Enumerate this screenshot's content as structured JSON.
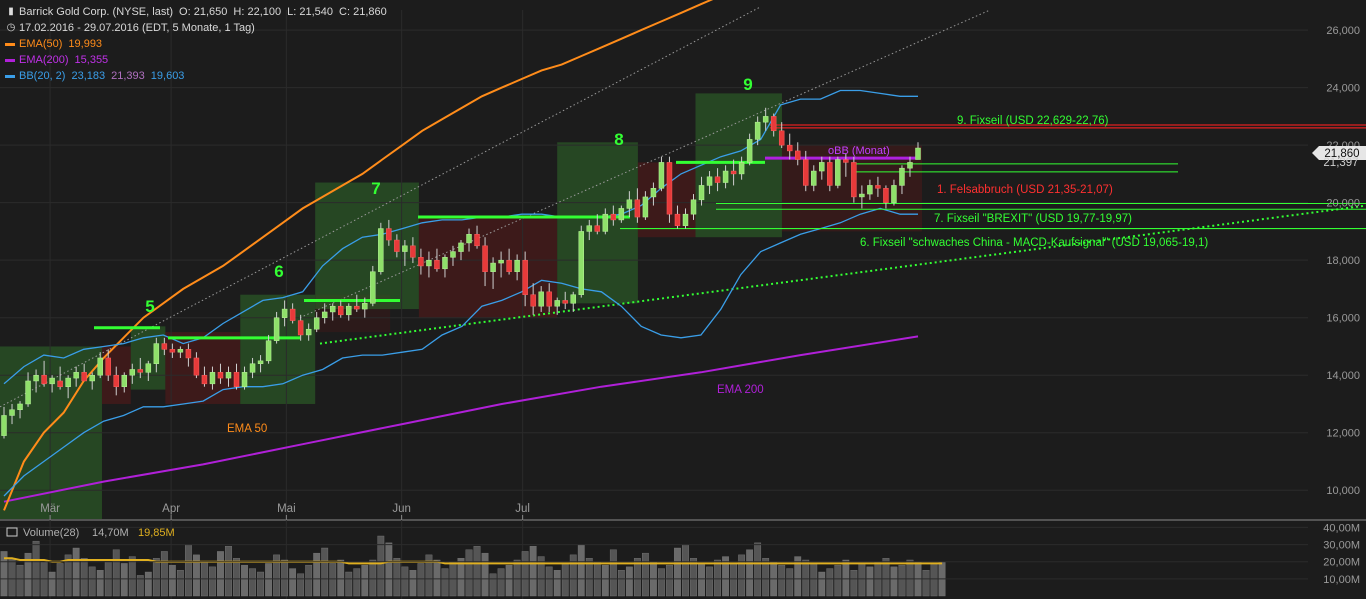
{
  "header": {
    "title": "Barrick Gold Corp. (NYSE, last)",
    "open_label": "O:",
    "open": "21,650",
    "high_label": "H:",
    "high": "22,100",
    "low_label": "L:",
    "low": "21,540",
    "close_label": "C:",
    "close": "21,860",
    "period": "17.02.2016 - 29.07.2016 (EDT, 5 Monate, 1 Tag)"
  },
  "indicators": {
    "ema50": {
      "label": "EMA(50)",
      "value": "19,993",
      "color": "#ff8c1a"
    },
    "ema200": {
      "label": "EMA(200)",
      "value": "15,355",
      "color": "#b020d8"
    },
    "bb": {
      "label": "BB(20, 2)",
      "upper": "23,183",
      "middle": "21,393",
      "lower": "19,603",
      "color": "#3a9ee8",
      "middle_color": "#b070c0"
    }
  },
  "volume_legend": {
    "label": "Volume(28)",
    "avg": "14,70M",
    "last": "19,85M",
    "avg_color": "#e0b020"
  },
  "last_price_tag": "21,860",
  "hidden_price_tag": "21,397",
  "annotations": {
    "wave_5": "5",
    "wave_6": "6",
    "wave_7": "7",
    "wave_8": "8",
    "wave_9": "9",
    "fix9": "9. Fixseil  (USD 22,629-22,76)",
    "obb": "oBB (Monat)",
    "fels1": "1. Felsabbruch (USD 21,35-21,07)",
    "fix7": "7. Fixseil  \"BREXIT\" (USD 19,77-19,97)",
    "fix6": "6. Fixseil  \"schwaches China - MACD-Kaufsignal\" (USD 19,065-19,1)",
    "ema50_label": "EMA 50",
    "ema200_label": "EMA 200"
  },
  "colors": {
    "background": "#1c1c1c",
    "up_candle": "#8fe06a",
    "down_candle": "#e83a3a",
    "green_line": "#33ff33",
    "red_line": "#e02020",
    "label_red": "#ff3030"
  },
  "chart_data": {
    "type": "candlestick",
    "ylim": [
      9.0,
      26.7
    ],
    "y_ticks": [
      "26,000",
      "24,000",
      "22,000",
      "20,000",
      "18,000",
      "16,000",
      "14,000",
      "12,000",
      "10,000"
    ],
    "y_tick_values": [
      26,
      24,
      22,
      20,
      18,
      16,
      14,
      12,
      10
    ],
    "x_labels": [
      {
        "label": "Mär",
        "index": 8
      },
      {
        "label": "Apr",
        "index": 29
      },
      {
        "label": "Mai",
        "index": 49
      },
      {
        "label": "Jun",
        "index": 69
      },
      {
        "label": "Jul",
        "index": 90
      }
    ],
    "volume_ticks": [
      "40,00M",
      "30,00M",
      "20,00M",
      "10,00M"
    ],
    "volume_tick_values": [
      40,
      30,
      20,
      10
    ],
    "volume_ylim": [
      0,
      42
    ],
    "candles": [
      [
        11.9,
        12.9,
        11.8,
        12.6
      ],
      [
        12.6,
        13.0,
        12.3,
        12.8
      ],
      [
        12.8,
        13.1,
        12.5,
        13.0
      ],
      [
        13.0,
        14.1,
        12.9,
        13.8
      ],
      [
        13.8,
        14.2,
        13.4,
        14.0
      ],
      [
        14.0,
        14.5,
        13.6,
        13.7
      ],
      [
        13.7,
        14.0,
        13.4,
        13.9
      ],
      [
        13.8,
        14.3,
        13.5,
        13.6
      ],
      [
        13.6,
        14.0,
        13.2,
        13.9
      ],
      [
        13.9,
        14.3,
        13.6,
        14.1
      ],
      [
        14.1,
        14.4,
        13.8,
        13.8
      ],
      [
        13.8,
        14.1,
        13.5,
        14.0
      ],
      [
        14.0,
        14.8,
        13.9,
        14.6
      ],
      [
        14.6,
        14.9,
        13.8,
        14.0
      ],
      [
        14.0,
        14.3,
        13.3,
        13.6
      ],
      [
        13.6,
        14.1,
        13.4,
        14.0
      ],
      [
        14.0,
        14.4,
        13.7,
        14.2
      ],
      [
        14.2,
        14.6,
        13.9,
        14.1
      ],
      [
        14.1,
        14.5,
        13.8,
        14.4
      ],
      [
        14.4,
        15.3,
        14.1,
        15.1
      ],
      [
        15.1,
        15.3,
        14.7,
        14.9
      ],
      [
        14.9,
        15.1,
        14.6,
        14.8
      ],
      [
        14.8,
        15.0,
        14.6,
        14.9
      ],
      [
        14.9,
        15.1,
        14.3,
        14.6
      ],
      [
        14.6,
        14.8,
        13.9,
        14.0
      ],
      [
        14.0,
        14.3,
        13.6,
        13.7
      ],
      [
        13.7,
        14.3,
        13.5,
        14.1
      ],
      [
        14.1,
        14.4,
        13.7,
        13.9
      ],
      [
        13.9,
        14.3,
        13.6,
        14.1
      ],
      [
        14.1,
        14.4,
        13.5,
        13.6
      ],
      [
        13.6,
        14.3,
        13.5,
        14.1
      ],
      [
        14.1,
        14.6,
        13.9,
        14.4
      ],
      [
        14.4,
        14.7,
        14.1,
        14.5
      ],
      [
        14.5,
        15.4,
        14.4,
        15.2
      ],
      [
        15.2,
        16.2,
        15.1,
        16.0
      ],
      [
        16.0,
        16.6,
        15.7,
        16.3
      ],
      [
        16.3,
        16.5,
        15.8,
        15.9
      ],
      [
        15.9,
        16.1,
        15.2,
        15.4
      ],
      [
        15.4,
        15.8,
        15.2,
        15.6
      ],
      [
        15.6,
        16.2,
        15.5,
        16.0
      ],
      [
        16.0,
        16.5,
        15.8,
        16.2
      ],
      [
        16.2,
        16.5,
        15.9,
        16.4
      ],
      [
        16.4,
        16.6,
        16.0,
        16.1
      ],
      [
        16.1,
        16.5,
        15.9,
        16.4
      ],
      [
        16.4,
        16.8,
        16.2,
        16.3
      ],
      [
        16.3,
        16.7,
        16.0,
        16.5
      ],
      [
        16.5,
        17.8,
        16.4,
        17.6
      ],
      [
        17.6,
        19.3,
        17.5,
        19.1
      ],
      [
        19.1,
        19.4,
        18.5,
        18.7
      ],
      [
        18.7,
        18.9,
        18.1,
        18.3
      ],
      [
        18.3,
        18.7,
        17.8,
        18.5
      ],
      [
        18.5,
        18.8,
        17.9,
        18.1
      ],
      [
        18.1,
        18.4,
        17.5,
        17.8
      ],
      [
        17.8,
        18.3,
        17.4,
        18.0
      ],
      [
        18.0,
        18.4,
        17.6,
        17.7
      ],
      [
        17.7,
        18.2,
        17.4,
        18.1
      ],
      [
        18.1,
        18.5,
        17.8,
        18.3
      ],
      [
        18.3,
        18.7,
        18.0,
        18.6
      ],
      [
        18.6,
        19.1,
        18.3,
        18.9
      ],
      [
        18.9,
        19.2,
        18.4,
        18.5
      ],
      [
        18.5,
        18.8,
        17.1,
        17.6
      ],
      [
        17.6,
        18.1,
        17.0,
        17.9
      ],
      [
        17.9,
        18.3,
        17.4,
        18.0
      ],
      [
        18.0,
        18.4,
        17.5,
        17.6
      ],
      [
        17.6,
        18.2,
        17.3,
        18.0
      ],
      [
        18.0,
        18.3,
        16.4,
        16.8
      ],
      [
        16.8,
        17.2,
        16.1,
        16.4
      ],
      [
        16.4,
        17.1,
        16.2,
        16.9
      ],
      [
        16.9,
        17.2,
        16.2,
        16.4
      ],
      [
        16.4,
        16.7,
        16.1,
        16.6
      ],
      [
        16.6,
        16.9,
        16.3,
        16.5
      ],
      [
        16.5,
        16.9,
        16.2,
        16.8
      ],
      [
        16.8,
        19.2,
        16.7,
        19.0
      ],
      [
        19.0,
        19.4,
        18.7,
        19.2
      ],
      [
        19.2,
        19.6,
        18.9,
        19.0
      ],
      [
        19.0,
        19.8,
        18.9,
        19.6
      ],
      [
        19.6,
        19.9,
        19.2,
        19.4
      ],
      [
        19.4,
        19.9,
        19.3,
        19.8
      ],
      [
        19.8,
        20.4,
        19.5,
        20.1
      ],
      [
        20.1,
        20.5,
        19.3,
        19.5
      ],
      [
        19.5,
        20.4,
        19.4,
        20.2
      ],
      [
        20.2,
        20.7,
        19.9,
        20.5
      ],
      [
        20.5,
        21.6,
        20.4,
        21.4
      ],
      [
        21.4,
        21.6,
        19.3,
        19.6
      ],
      [
        19.6,
        19.9,
        19.1,
        19.2
      ],
      [
        19.2,
        19.8,
        19.1,
        19.6
      ],
      [
        19.6,
        20.3,
        19.4,
        20.1
      ],
      [
        20.1,
        20.9,
        19.9,
        20.6
      ],
      [
        20.6,
        21.1,
        20.3,
        20.9
      ],
      [
        20.9,
        21.2,
        20.4,
        20.7
      ],
      [
        20.7,
        21.3,
        20.5,
        21.1
      ],
      [
        21.1,
        21.5,
        20.6,
        21.0
      ],
      [
        21.0,
        21.6,
        20.8,
        21.4
      ],
      [
        21.4,
        22.4,
        21.3,
        22.2
      ],
      [
        22.2,
        23.0,
        22.0,
        22.8
      ],
      [
        22.8,
        23.3,
        22.5,
        23.0
      ],
      [
        23.0,
        23.1,
        22.3,
        22.5
      ],
      [
        22.5,
        22.8,
        21.9,
        22.0
      ],
      [
        22.0,
        22.4,
        21.5,
        21.8
      ],
      [
        21.8,
        22.1,
        21.3,
        21.5
      ],
      [
        21.5,
        21.8,
        20.4,
        20.6
      ],
      [
        20.6,
        21.3,
        20.4,
        21.1
      ],
      [
        21.1,
        21.6,
        20.8,
        21.4
      ],
      [
        21.4,
        21.6,
        20.4,
        20.6
      ],
      [
        20.6,
        21.6,
        20.5,
        21.5
      ],
      [
        21.5,
        21.7,
        20.9,
        21.4
      ],
      [
        21.4,
        21.6,
        20.0,
        20.2
      ],
      [
        20.2,
        20.6,
        19.8,
        20.3
      ],
      [
        20.3,
        20.8,
        20.1,
        20.6
      ],
      [
        20.6,
        20.9,
        20.2,
        20.5
      ],
      [
        20.5,
        20.6,
        19.8,
        20.0
      ],
      [
        20.0,
        20.8,
        19.9,
        20.6
      ],
      [
        20.6,
        21.3,
        20.3,
        21.2
      ],
      [
        21.2,
        21.6,
        20.9,
        21.4
      ],
      [
        21.5,
        22.1,
        21.5,
        21.9
      ]
    ],
    "ema50": [
      [
        0,
        9.3
      ],
      [
        20,
        11.0
      ],
      [
        40,
        12.0
      ],
      [
        60,
        12.7
      ],
      [
        80,
        13.8
      ],
      [
        100,
        14.6
      ],
      [
        120,
        15.3
      ],
      [
        140,
        16.0
      ],
      [
        160,
        16.5
      ],
      [
        180,
        17.0
      ],
      [
        200,
        17.4
      ],
      [
        220,
        17.8
      ],
      [
        240,
        18.3
      ],
      [
        260,
        18.8
      ],
      [
        280,
        19.3
      ],
      [
        300,
        19.8
      ],
      [
        320,
        20.2
      ],
      [
        340,
        20.6
      ],
      [
        360,
        21.0
      ],
      [
        380,
        21.5
      ],
      [
        400,
        22.0
      ],
      [
        420,
        22.5
      ],
      [
        440,
        22.9
      ],
      [
        460,
        23.3
      ],
      [
        480,
        23.7
      ],
      [
        500,
        24.0
      ],
      [
        520,
        24.3
      ],
      [
        540,
        24.6
      ],
      [
        560,
        24.8
      ],
      [
        580,
        25.1
      ],
      [
        600,
        25.4
      ],
      [
        620,
        25.7
      ],
      [
        640,
        26.0
      ],
      [
        660,
        26.3
      ],
      [
        680,
        26.6
      ],
      [
        700,
        26.9
      ],
      [
        720,
        27.2
      ],
      [
        740,
        27.5
      ],
      [
        760,
        27.8
      ],
      [
        780,
        28.1
      ],
      [
        800,
        28.5
      ],
      [
        820,
        28.9
      ],
      [
        840,
        29.4
      ],
      [
        860,
        29.8
      ],
      [
        880,
        30.2
      ],
      [
        900,
        30.6
      ],
      [
        918,
        30.9
      ]
    ],
    "ema200": [
      [
        0,
        9.6
      ],
      [
        100,
        10.3
      ],
      [
        200,
        10.9
      ],
      [
        300,
        11.6
      ],
      [
        400,
        12.3
      ],
      [
        500,
        13.0
      ],
      [
        600,
        13.6
      ],
      [
        700,
        14.1
      ],
      [
        800,
        14.7
      ],
      [
        918,
        15.35
      ]
    ],
    "bb_upper": [
      [
        0,
        13.7
      ],
      [
        20,
        14.3
      ],
      [
        40,
        14.7
      ],
      [
        60,
        14.6
      ],
      [
        80,
        14.9
      ],
      [
        100,
        15.0
      ],
      [
        120,
        15.1
      ],
      [
        140,
        15.3
      ],
      [
        160,
        15.4
      ],
      [
        180,
        15.1
      ],
      [
        200,
        15.3
      ],
      [
        220,
        15.8
      ],
      [
        240,
        16.2
      ],
      [
        260,
        16.6
      ],
      [
        280,
        16.7
      ],
      [
        300,
        16.9
      ],
      [
        320,
        17.8
      ],
      [
        340,
        18.4
      ],
      [
        360,
        18.8
      ],
      [
        380,
        18.9
      ],
      [
        400,
        19.1
      ],
      [
        420,
        19.3
      ],
      [
        440,
        19.4
      ],
      [
        460,
        19.4
      ],
      [
        480,
        19.5
      ],
      [
        500,
        19.5
      ],
      [
        520,
        19.6
      ],
      [
        540,
        19.6
      ],
      [
        560,
        19.5
      ],
      [
        580,
        19.5
      ],
      [
        600,
        19.5
      ],
      [
        620,
        19.6
      ],
      [
        640,
        19.9
      ],
      [
        660,
        20.5
      ],
      [
        680,
        21.0
      ],
      [
        700,
        21.3
      ],
      [
        720,
        21.6
      ],
      [
        740,
        21.8
      ],
      [
        760,
        22.2
      ],
      [
        780,
        23.4
      ],
      [
        800,
        23.6
      ],
      [
        820,
        23.6
      ],
      [
        840,
        23.9
      ],
      [
        860,
        23.9
      ],
      [
        880,
        23.8
      ],
      [
        900,
        23.7
      ],
      [
        918,
        23.7
      ]
    ],
    "bb_lower": [
      [
        0,
        9.8
      ],
      [
        20,
        10.5
      ],
      [
        40,
        11.0
      ],
      [
        60,
        11.5
      ],
      [
        80,
        12.0
      ],
      [
        100,
        12.4
      ],
      [
        120,
        12.6
      ],
      [
        140,
        12.9
      ],
      [
        160,
        12.9
      ],
      [
        180,
        13.0
      ],
      [
        200,
        13.1
      ],
      [
        220,
        13.5
      ],
      [
        240,
        13.6
      ],
      [
        260,
        13.6
      ],
      [
        280,
        13.7
      ],
      [
        300,
        14.0
      ],
      [
        320,
        14.2
      ],
      [
        340,
        14.6
      ],
      [
        360,
        14.7
      ],
      [
        380,
        14.7
      ],
      [
        400,
        14.8
      ],
      [
        420,
        14.9
      ],
      [
        440,
        15.4
      ],
      [
        460,
        15.7
      ],
      [
        480,
        16.4
      ],
      [
        500,
        16.6
      ],
      [
        520,
        16.9
      ],
      [
        540,
        17.3
      ],
      [
        560,
        17.2
      ],
      [
        580,
        17.0
      ],
      [
        600,
        16.9
      ],
      [
        620,
        16.4
      ],
      [
        640,
        15.7
      ],
      [
        660,
        15.4
      ],
      [
        680,
        15.3
      ],
      [
        700,
        15.4
      ],
      [
        720,
        16.3
      ],
      [
        740,
        17.5
      ],
      [
        760,
        18.3
      ],
      [
        780,
        18.6
      ],
      [
        800,
        18.9
      ],
      [
        820,
        19.1
      ],
      [
        840,
        19.3
      ],
      [
        860,
        19.6
      ],
      [
        880,
        19.8
      ],
      [
        900,
        19.6
      ],
      [
        918,
        19.6
      ]
    ],
    "volume": [
      26,
      22,
      18,
      25,
      32,
      20,
      14,
      19,
      24,
      28,
      22,
      17,
      15,
      20,
      27,
      19,
      23,
      12,
      14,
      22,
      26,
      18,
      15,
      30,
      24,
      20,
      17,
      26,
      29,
      22,
      18,
      16,
      14,
      19,
      24,
      21,
      16,
      13,
      18,
      25,
      28,
      19,
      21,
      14,
      16,
      18,
      21,
      35,
      31,
      22,
      17,
      15,
      19,
      24,
      21,
      16,
      20,
      22,
      27,
      29,
      25,
      13,
      16,
      18,
      21,
      26,
      29,
      23,
      17,
      15,
      19,
      24,
      30,
      22,
      20,
      18,
      27,
      15,
      17,
      22,
      25,
      20,
      16,
      18,
      28,
      30,
      22,
      19,
      17,
      21,
      23,
      19,
      24,
      27,
      31,
      22,
      20,
      18,
      16,
      23,
      21,
      19,
      14,
      16,
      18,
      21,
      15,
      19,
      17,
      20,
      22,
      17,
      18,
      21,
      20,
      15,
      19,
      20
    ],
    "volume_avg": [
      22,
      22,
      21,
      21,
      21,
      21,
      20,
      20,
      21,
      21,
      21,
      21,
      21,
      21,
      21,
      21,
      21,
      21,
      21,
      20,
      20,
      20,
      20,
      20,
      20,
      20,
      20,
      20,
      20,
      20,
      20,
      20,
      20,
      20,
      20,
      20,
      20,
      20,
      20,
      20,
      20,
      20,
      20,
      19,
      19,
      19,
      19,
      19,
      20,
      20,
      20,
      20,
      20,
      20,
      20,
      19,
      19,
      19,
      19,
      19,
      19,
      19,
      19,
      19,
      19,
      19,
      19,
      19,
      19,
      19,
      19,
      19,
      19,
      19,
      19,
      19,
      19,
      19,
      19,
      19,
      19,
      19,
      19,
      19,
      19,
      19,
      19,
      19,
      19,
      19,
      19,
      19,
      19,
      19,
      19,
      19,
      19,
      19,
      19,
      19,
      19,
      19,
      19,
      19,
      19,
      19,
      19,
      19,
      19,
      19,
      19,
      19,
      19,
      19,
      19,
      19,
      19,
      19
    ]
  }
}
